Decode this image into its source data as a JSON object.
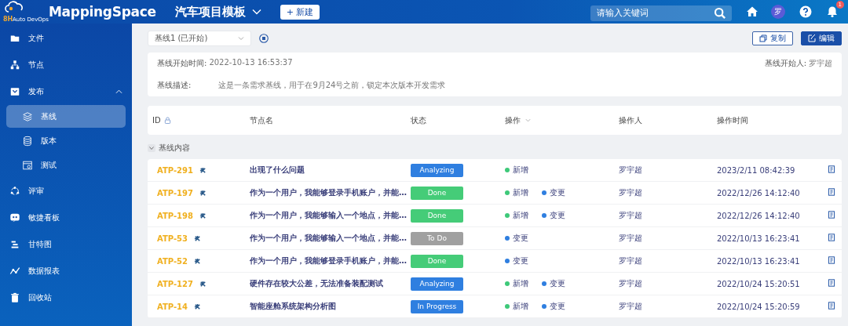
{
  "header": {
    "logo_mark": "8H",
    "logo_caption": "Auto DevOps",
    "brand": "MappingSpace",
    "project": "汽车项目模板",
    "new_button": "+ 新建",
    "search": {
      "placeholder": "请输入关键词"
    },
    "avatar": "罗",
    "notification_count": "1"
  },
  "sidebar": {
    "items": [
      {
        "label": "文件",
        "selected": false
      },
      {
        "label": "节点",
        "selected": false
      },
      {
        "label": "发布",
        "selected": false,
        "expanded": true,
        "children": [
          {
            "label": "基线",
            "selected": true
          },
          {
            "label": "版本",
            "selected": false
          },
          {
            "label": "测试",
            "selected": false
          }
        ]
      },
      {
        "label": "评审",
        "selected": false
      },
      {
        "label": "敏捷看板",
        "selected": false
      },
      {
        "label": "甘特图",
        "selected": false
      },
      {
        "label": "数据报表",
        "selected": false
      },
      {
        "label": "回收站",
        "selected": false
      }
    ]
  },
  "toolbar": {
    "baseline_select": "基线1 (已开始)",
    "copy_button": "复制",
    "edit_button": "编辑"
  },
  "info": {
    "start_time_label": "基线开始时间:",
    "start_time": "2022-10-13 16:53:37",
    "starter_label": "基线开始人:",
    "starter": "罗宇超",
    "description_label": "基线描述:",
    "description": "这是一条需求基线，用于在9月24号之前，锁定本次版本开发需求"
  },
  "table": {
    "columns": [
      "ID",
      "节点名",
      "状态",
      "操作",
      "操作人",
      "操作时间"
    ],
    "section": {
      "label": "基线内容",
      "expanded": true
    },
    "rows": [
      {
        "id": "ATP-291",
        "name": "出现了什么问题",
        "status": {
          "label": "Analyzing",
          "color": "#2f7fe0"
        },
        "operations": [
          {
            "label": "新增",
            "color": "#3ec979"
          }
        ],
        "operator": "罗宇超",
        "time": "2023/2/11 08:42:39"
      },
      {
        "id": "ATP-197",
        "name": "作为一个用户，我能够登录手机账户，并能…",
        "status": {
          "label": "Done",
          "color": "#45cc78"
        },
        "operations": [
          {
            "label": "新增",
            "color": "#3ec979"
          },
          {
            "label": "变更",
            "color": "#2f7fe0"
          }
        ],
        "operator": "罗宇超",
        "time": "2022/12/26 14:12:40"
      },
      {
        "id": "ATP-198",
        "name": "作为一个用户，我能够输入一个地点，并能…",
        "status": {
          "label": "Done",
          "color": "#45cc78"
        },
        "operations": [
          {
            "label": "新增",
            "color": "#3ec979"
          },
          {
            "label": "变更",
            "color": "#2f7fe0"
          }
        ],
        "operator": "罗宇超",
        "time": "2022/12/26 14:12:40"
      },
      {
        "id": "ATP-53",
        "name": "作为一个用户，我能够输入一个地点，并能…",
        "status": {
          "label": "To Do",
          "color": "#a0a0a0"
        },
        "operations": [
          {
            "label": "变更",
            "color": "#2f7fe0"
          }
        ],
        "operator": "罗宇超",
        "time": "2022/10/13 16:23:41"
      },
      {
        "id": "ATP-52",
        "name": "作为一个用户，我能够登录手机账户，并能…",
        "status": {
          "label": "Done",
          "color": "#45cc78"
        },
        "operations": [
          {
            "label": "变更",
            "color": "#2f7fe0"
          }
        ],
        "operator": "罗宇超",
        "time": "2022/10/13 16:23:41"
      },
      {
        "id": "ATP-127",
        "name": "硬件存在较大公差，无法准备装配测试",
        "status": {
          "label": "Analyzing",
          "color": "#2f7fe0"
        },
        "operations": [
          {
            "label": "新增",
            "color": "#3ec979"
          },
          {
            "label": "变更",
            "color": "#2f7fe0"
          }
        ],
        "operator": "罗宇超",
        "time": "2022/10/24 15:20:51"
      },
      {
        "id": "ATP-14",
        "name": "智能座舱系统架构分析图",
        "status": {
          "label": "In Progress",
          "color": "#2f7fe0"
        },
        "operations": [
          {
            "label": "新增",
            "color": "#3ec979"
          },
          {
            "label": "变更",
            "color": "#2f7fe0"
          }
        ],
        "operator": "罗宇超",
        "time": "2022/10/24 15:20:59"
      }
    ]
  }
}
